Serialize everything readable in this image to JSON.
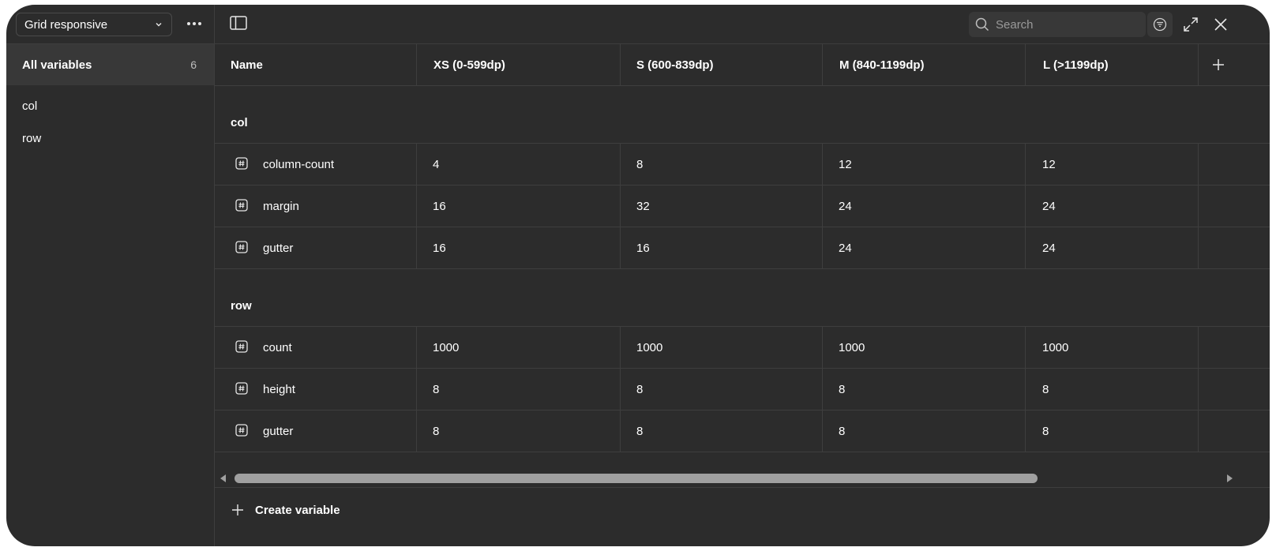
{
  "sidebar": {
    "collection_name": "Grid responsive",
    "all_variables_label": "All variables",
    "all_variables_count": "6",
    "groups": [
      {
        "label": "col"
      },
      {
        "label": "row"
      }
    ]
  },
  "toolbar": {
    "search_placeholder": "Search"
  },
  "table": {
    "columns": [
      "Name",
      "XS (0-599dp)",
      "S (600-839dp)",
      "M (840-1199dp)",
      "L (>1199dp)"
    ],
    "groups": [
      {
        "name": "col",
        "rows": [
          {
            "name": "column-count",
            "values": [
              "4",
              "8",
              "12",
              "12"
            ]
          },
          {
            "name": "margin",
            "values": [
              "16",
              "32",
              "24",
              "24"
            ]
          },
          {
            "name": "gutter",
            "values": [
              "16",
              "16",
              "24",
              "24"
            ]
          }
        ]
      },
      {
        "name": "row",
        "rows": [
          {
            "name": "count",
            "values": [
              "1000",
              "1000",
              "1000",
              "1000"
            ]
          },
          {
            "name": "height",
            "values": [
              "8",
              "8",
              "8",
              "8"
            ]
          },
          {
            "name": "gutter",
            "values": [
              "8",
              "8",
              "8",
              "8"
            ]
          }
        ]
      }
    ]
  },
  "footer": {
    "create_variable_label": "Create variable"
  }
}
